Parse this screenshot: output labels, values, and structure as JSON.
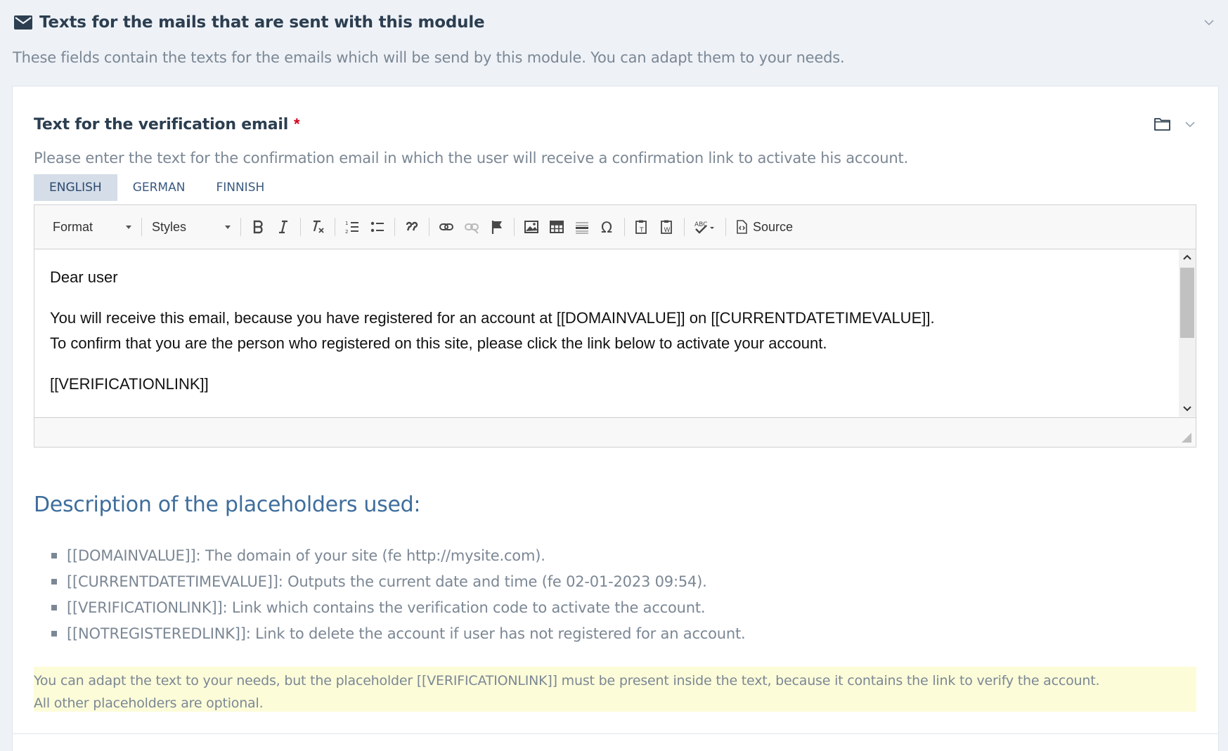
{
  "section": {
    "title": "Texts for the mails that are sent with this module",
    "description": "These fields contain the texts for the emails which will be send by this module. You can adapt them to your needs.",
    "icon": "envelope-icon"
  },
  "field": {
    "title": "Text for the verification email",
    "required_mark": "*",
    "description": "Please enter the text for the confirmation email in which the user will receive a confirmation link to activate his account.",
    "tabs": [
      "ENGLISH",
      "GERMAN",
      "FINNISH"
    ],
    "active_tab": "ENGLISH"
  },
  "toolbar": {
    "format_label": "Format",
    "styles_label": "Styles",
    "source_label": "Source"
  },
  "editor_content": {
    "greeting": "Dear user",
    "line1": "You will receive this email, because you have registered for an account at [[DOMAINVALUE]] on [[CURRENTDATETIMEVALUE]].",
    "line2": "To confirm that you are the person who registered on this site, please click the link below to activate your account.",
    "link": "[[VERIFICATIONLINK]]"
  },
  "placeholders": {
    "title": "Description of the placeholders used:",
    "items": [
      "[[DOMAINVALUE]]: The domain of your site (fe http://mysite.com).",
      "[[CURRENTDATETIMEVALUE]]: Outputs the current date and time (fe 02-01-2023 09:54).",
      "[[VERIFICATIONLINK]]: Link which contains the verification code to activate the account.",
      "[[NOTREGISTEREDLINK]]: Link to delete the account if user has not registered for an account."
    ]
  },
  "note": {
    "line1": "You can adapt the text to your needs, but the placeholder [[VERIFICATIONLINK]] must be present inside the text, because it contains the link to verify the account.",
    "line2": "All other placeholders are optional."
  },
  "colors": {
    "required": "#d0021b",
    "heading_blue": "#3e6d9c",
    "note_background": "#fcfcd9",
    "active_tab": "#d4dde8"
  }
}
